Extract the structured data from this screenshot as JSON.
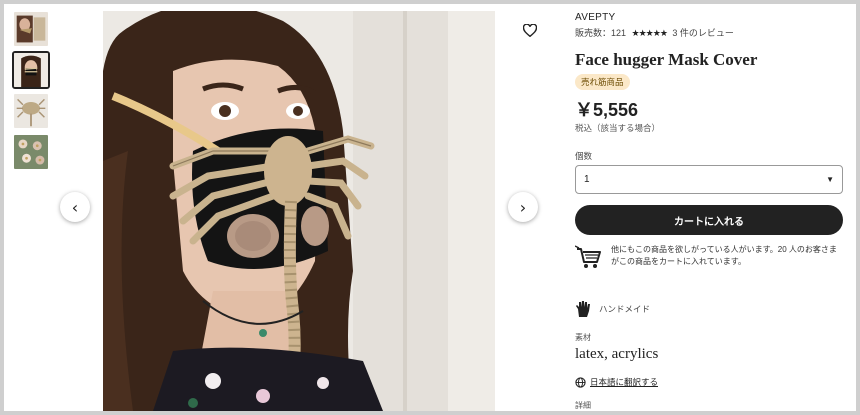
{
  "gallery": {
    "thumbnails": [
      {
        "name": "thumbnail-1",
        "active": false
      },
      {
        "name": "thumbnail-2",
        "active": true
      },
      {
        "name": "thumbnail-3",
        "active": false
      },
      {
        "name": "thumbnail-4",
        "active": false
      }
    ],
    "prev_icon": "chevron-left-icon",
    "next_icon": "chevron-right-icon",
    "prev_glyph": "‹",
    "next_glyph": "›"
  },
  "favorite": {
    "icon": "heart-icon"
  },
  "product": {
    "shop_name": "AVEPTY",
    "sales_text": "販売数：121",
    "stars": "★★★★★",
    "reviews_text": "3 件のレビュー",
    "title": "Face hugger Mask Cover",
    "badge": "売れ筋商品",
    "price": "￥5,556",
    "tax_note": "税込（該当する場合）"
  },
  "quantity": {
    "label": "個数",
    "selected": "1",
    "caret": "▼"
  },
  "cart": {
    "button_label": "カートに入れる",
    "demand_text": "他にもこの商品を欲しがっている人がいます。20 人のお客さまがこの商品をカートに入れています。"
  },
  "highlights": {
    "handmade_label": "ハンドメイド",
    "materials_label": "素材",
    "materials_value": "latex, acrylics",
    "translate_link": "日本語に翻訳する",
    "details_label": "詳細"
  },
  "colors": {
    "accent": "#222222",
    "badge_bg": "#fbe8c8"
  }
}
